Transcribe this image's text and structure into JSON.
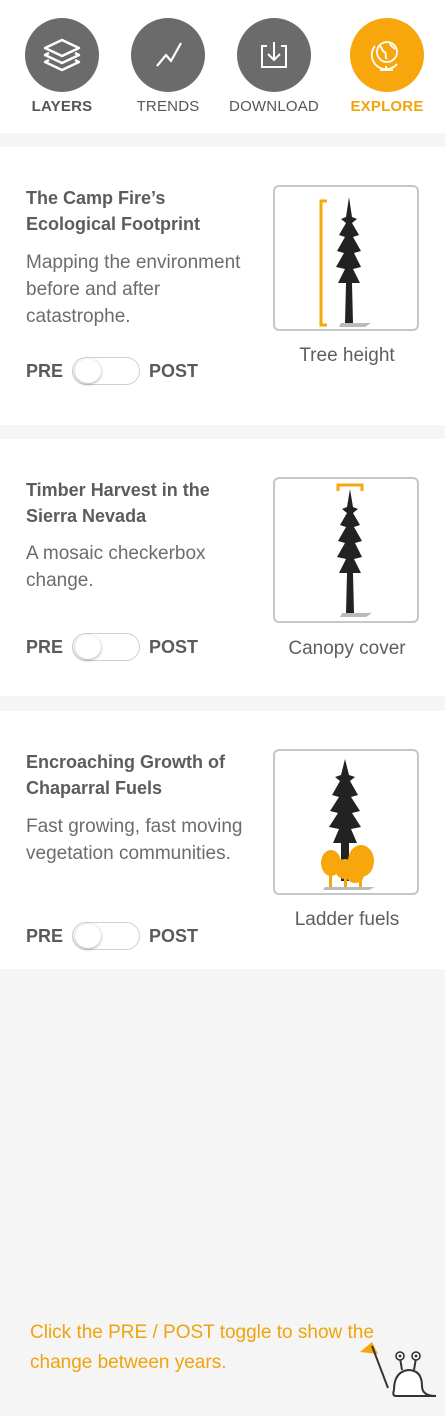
{
  "nav": {
    "items": [
      {
        "label": "LAYERS",
        "icon": "layers-icon"
      },
      {
        "label": "TRENDS",
        "icon": "trend-line-icon"
      },
      {
        "label": "DOWNLOAD",
        "icon": "download-icon"
      },
      {
        "label": "EXPLORE",
        "icon": "globe-icon"
      }
    ],
    "active": "EXPLORE"
  },
  "cards": [
    {
      "title": "The Camp Fire’s Ecological Footprint",
      "description": "Mapping the environment before and after catastrophe.",
      "pre": "PRE",
      "post": "POST",
      "figure_caption": "Tree height",
      "figure_icon": "tree-height-icon"
    },
    {
      "title": "Timber Harvest in the Sierra Nevada",
      "description": "A mosaic checkerbox change.",
      "pre": "PRE",
      "post": "POST",
      "figure_caption": "Canopy cover",
      "figure_icon": "canopy-cover-icon"
    },
    {
      "title": "Encroaching Growth of Chaparral Fuels",
      "description": "Fast growing, fast moving vegetation communities.",
      "pre": "PRE",
      "post": "POST",
      "figure_caption": "Ladder fuels",
      "figure_icon": "ladder-fuels-icon"
    }
  ],
  "hint": {
    "text": "Click the PRE / POST toggle to show the change between years."
  },
  "colors": {
    "accent": "#f7a60c",
    "nav_icon_bg": "#6b6b6b",
    "text": "#5c5c5c"
  }
}
